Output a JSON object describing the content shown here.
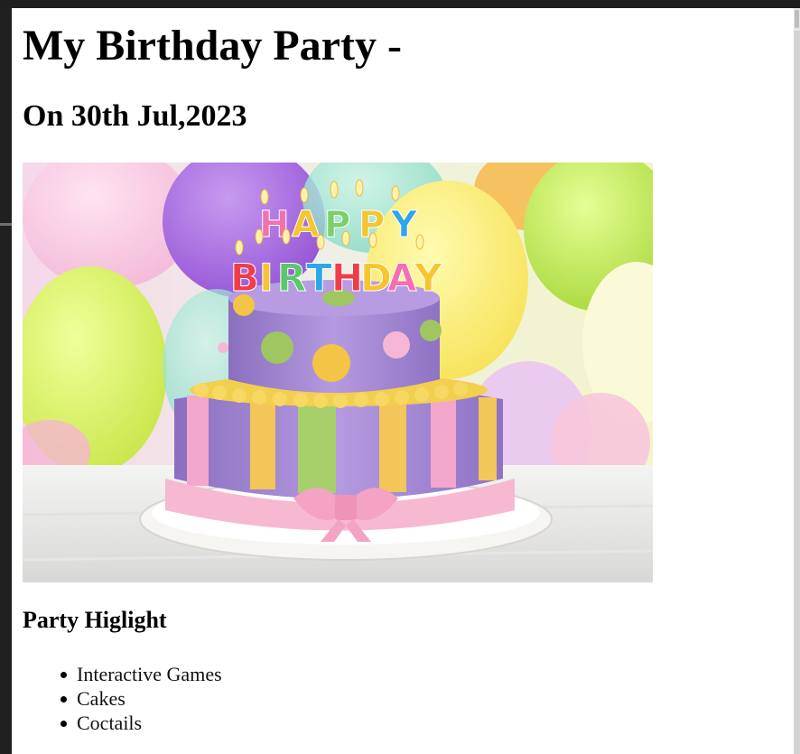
{
  "page": {
    "title": "My Birthday Party -",
    "subtitle": "On 30th Jul,2023",
    "hero_image": {
      "candle_text_line1": "HAPPY",
      "candle_text_line2": "BIRTHDAY"
    },
    "highlights_heading": "Party Higlight",
    "highlights": [
      "Interactive Games",
      "Cakes",
      "Coctails"
    ]
  },
  "colors": {
    "background": "#ffffff",
    "text": "#000000",
    "window_frame": "#1e1e1e"
  }
}
